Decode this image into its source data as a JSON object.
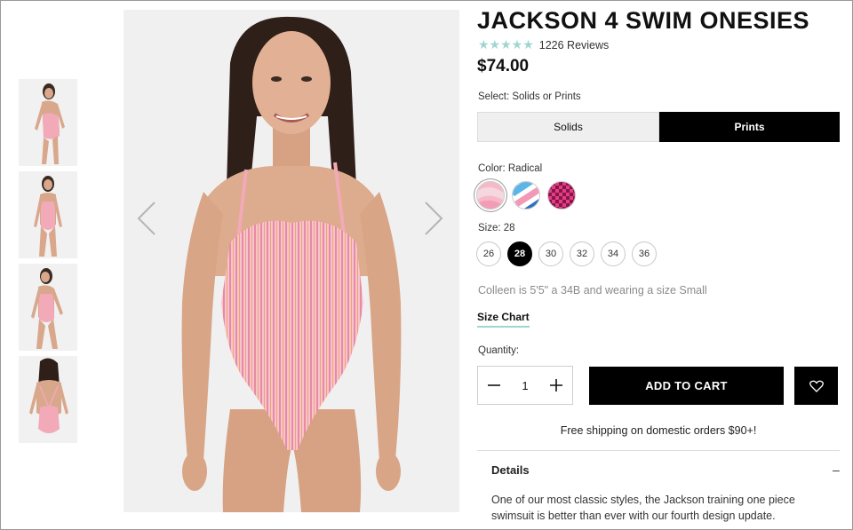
{
  "product": {
    "title": "JACKSON 4 SWIM ONESIES",
    "stars": "★★★★★",
    "rating": 4.5,
    "reviews": "1226 Reviews",
    "price": "$74.00"
  },
  "options": {
    "select_label": "Select: Solids or Prints",
    "toggle": [
      "Solids",
      "Prints"
    ],
    "selected_toggle": "Prints",
    "color_label": "Color: Radical",
    "swatches": [
      {
        "name": "Radical",
        "colors": [
          "#f7b8c8",
          "#f4d7df",
          "#f29db5"
        ]
      },
      {
        "name": "Stripe",
        "colors": [
          "#5bb5e6",
          "#ffffff",
          "#f19ab8"
        ]
      },
      {
        "name": "Checker",
        "colors": [
          "#8a1446",
          "#e04088"
        ]
      }
    ],
    "size_label": "Size: 28",
    "sizes": [
      "26",
      "28",
      "30",
      "32",
      "34",
      "36"
    ],
    "selected_size": "28",
    "model_note": "Colleen is 5'5\" a 34B and wearing a size Small",
    "size_chart": "Size Chart"
  },
  "cart": {
    "quantity_label": "Quantity:",
    "quantity": "1",
    "add_to_cart": "ADD TO CART"
  },
  "shipping": "Free shipping on domestic orders $90+!",
  "details": {
    "heading": "Details",
    "toggle": "–",
    "text": "One of our most classic styles, the Jackson training one piece swimsuit is better than ever with our fourth design update."
  },
  "icons": {
    "prev": "chevron-left-icon",
    "next": "chevron-right-icon",
    "minus": "minus-icon",
    "plus": "plus-icon",
    "wishlist": "heart-icon"
  },
  "colors": {
    "accent": "#9fd6d2",
    "primary": "#000000",
    "swimsuit": "#f2a9b8"
  }
}
